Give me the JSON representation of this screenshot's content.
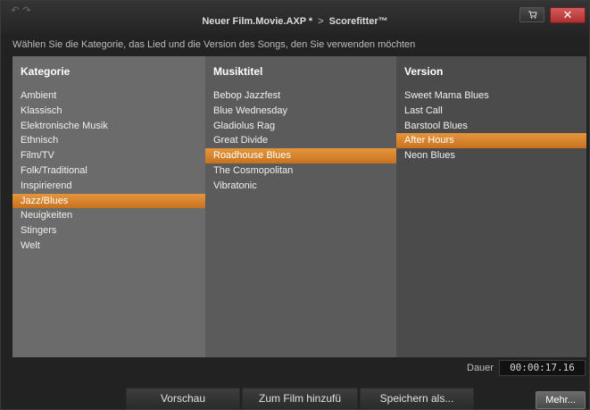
{
  "titlebar": {
    "project": "Neuer Film.Movie.AXP *",
    "separator": ">",
    "tool": "Scorefitter™",
    "undo_icon": "undo-icon",
    "redo_icon": "redo-icon",
    "close_label": "✕"
  },
  "instruction": "Wählen Sie die Kategorie, das Lied und die Version des Songs, den Sie verwenden möchten",
  "columns": {
    "category": {
      "header": "Kategorie",
      "items": [
        "Ambient",
        "Klassisch",
        "Elektronische Musik",
        "Ethnisch",
        "Film/TV",
        "Folk/Traditional",
        "Inspirierend",
        "Jazz/Blues",
        "Neuigkeiten",
        "Stingers",
        "Welt"
      ],
      "selected": "Jazz/Blues"
    },
    "song": {
      "header": "Musiktitel",
      "items": [
        "Bebop Jazzfest",
        "Blue Wednesday",
        "Gladiolus Rag",
        "Great Divide",
        "Roadhouse Blues",
        "The Cosmopolitan",
        "Vibratonic"
      ],
      "selected": "Roadhouse Blues"
    },
    "version": {
      "header": "Version",
      "items": [
        "Sweet Mama Blues",
        "Last Call",
        "Barstool Blues",
        "After Hours",
        "Neon Blues"
      ],
      "selected": "After Hours"
    }
  },
  "duration": {
    "label": "Dauer",
    "value": "00:00:17.16"
  },
  "buttons": {
    "preview": "Vorschau",
    "add_to_film": "Zum Film hinzufü",
    "save_as": "Speichern als...",
    "more": "Mehr..."
  },
  "colors": {
    "selection": "#d98330",
    "close": "#c04040"
  }
}
